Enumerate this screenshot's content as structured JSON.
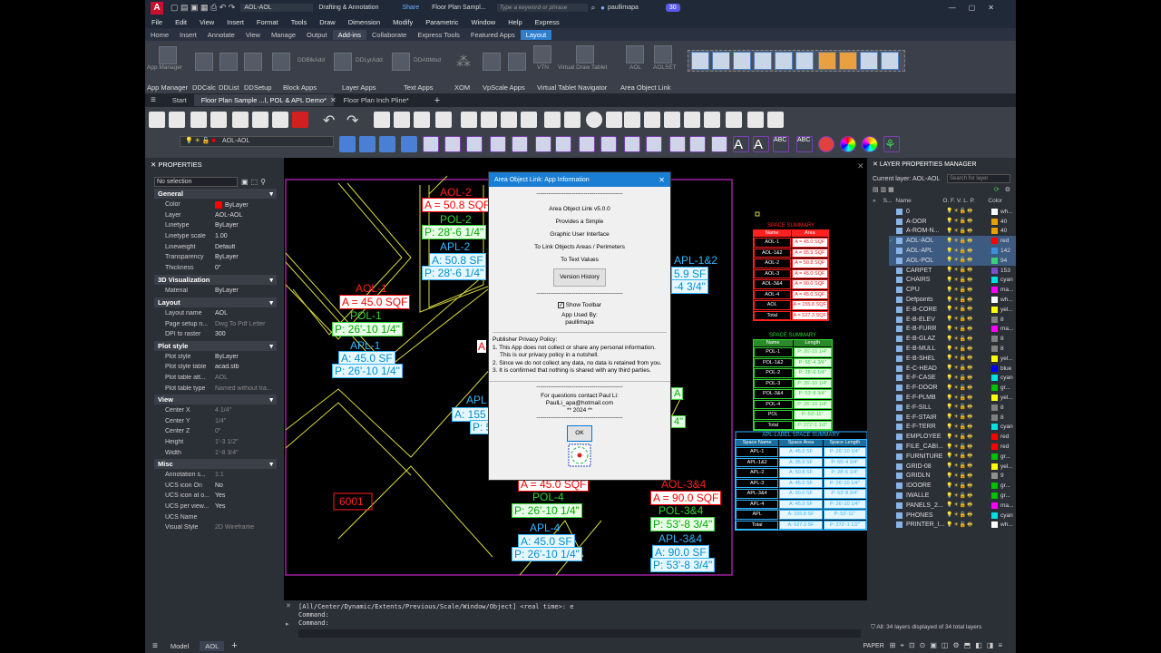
{
  "title_bar": {
    "app_badge": "A",
    "layer_combo": "AOL-AOL",
    "workspace": "Drafting & Annotation",
    "share": "Share",
    "doc_title": "Floor Plan Sampl...",
    "search_placeholder": "Type a keyword or phrase",
    "user": "paullimapa",
    "badge": "30"
  },
  "menu": [
    "File",
    "Edit",
    "View",
    "Insert",
    "Format",
    "Tools",
    "Draw",
    "Dimension",
    "Modify",
    "Parametric",
    "Window",
    "Help",
    "Express"
  ],
  "ribbon_tabs": [
    "Home",
    "Insert",
    "Annotate",
    "View",
    "Manage",
    "Output",
    "Add-ins",
    "Collaborate",
    "Express Tools",
    "Featured Apps",
    "Layout"
  ],
  "ribbon": {
    "icon_labels": [
      "App Manager",
      "DDBlkAdd",
      "DDLyrAdd",
      "DDAttMod",
      "VTN",
      "Virtual Draw Tablet",
      "AOL",
      "AOLSET"
    ],
    "panels": [
      "App Manager",
      "DDCalc",
      "DDList",
      "DDSetup",
      "Block Apps",
      "Layer Apps",
      "Text Apps",
      "XOM",
      "VpScale Apps",
      "Virtual Tablet Navigator",
      "Area Object Link"
    ]
  },
  "doc_tabs": [
    "Start",
    "Floor Plan Sample ...l, POL & APL Demo*",
    "Floor Plan Inch Pline*"
  ],
  "layer_toolbar_value": "AOL-AOL",
  "properties": {
    "header": "PROPERTIES",
    "selection": "No selection",
    "sections": [
      {
        "title": "General",
        "rows": [
          [
            "Color",
            "ByLayer"
          ],
          [
            "Layer",
            "AOL-AOL"
          ],
          [
            "Linetype",
            "ByLayer"
          ],
          [
            "Linetype scale",
            "1.00"
          ],
          [
            "Lineweight",
            "Default"
          ],
          [
            "Transparency",
            "ByLayer"
          ],
          [
            "Thickness",
            "0\""
          ]
        ]
      },
      {
        "title": "3D Visualization",
        "rows": [
          [
            "Material",
            "ByLayer"
          ]
        ]
      },
      {
        "title": "Layout",
        "rows": [
          [
            "Layout name",
            "AOL"
          ],
          [
            "Page setup n...",
            "Dwg To Pdf Letter"
          ],
          [
            "DPI to raster",
            "300"
          ]
        ]
      },
      {
        "title": "Plot style",
        "rows": [
          [
            "Plot style",
            "ByLayer"
          ],
          [
            "Plot style table",
            "acad.stb"
          ],
          [
            "Plot table att...",
            "AOL"
          ],
          [
            "Plot table type",
            "Named without tra..."
          ]
        ]
      },
      {
        "title": "View",
        "rows": [
          [
            "Center X",
            "4 1/4\""
          ],
          [
            "Center Y",
            "1/4\""
          ],
          [
            "Center Z",
            "0\""
          ],
          [
            "Height",
            "1'-3 1/2\""
          ],
          [
            "Width",
            "1'-8 3/4\""
          ]
        ]
      },
      {
        "title": "Misc",
        "rows": [
          [
            "Annotation s...",
            "1:1"
          ],
          [
            "UCS icon On",
            "No"
          ],
          [
            "UCS icon at o...",
            "Yes"
          ],
          [
            "UCS per view...",
            "Yes"
          ],
          [
            "UCS Name",
            ""
          ],
          [
            "Visual Style",
            "2D Wireframe"
          ]
        ]
      }
    ]
  },
  "drawing": {
    "labels": {
      "aol2": "AOL-2",
      "aol2_area": "A = 50.8 SQF",
      "pol2": "POL-2",
      "pol2_p": "P: 28'-6 1/4\"",
      "apl2": "APL-2",
      "apl2_a": "A: 50.8 SF",
      "apl2_p": "P: 28'-6 1/4\"",
      "aol1": "AOL-1",
      "aol1_area": "A = 45.0 SQF",
      "pol1": "POL-1",
      "pol1_p": "P: 26'-10 1/4\"",
      "apl1": "APL-1",
      "apl1_a": "A: 45.0 SF",
      "apl1_p": "P: 26'-10 1/4\"",
      "apl12": "APL-1&2",
      "apl12_a": "5.9 SF",
      "apl12_p": "-4 3/4\"",
      "aol4_area": "A = 45.0 SQF",
      "pol4": "POL-4",
      "pol4_p": "P: 26'-10 1/4\"",
      "apl4": "APL-4",
      "apl4_a": "A: 45.0 SF",
      "apl4_p": "P: 26'-10 1/4\"",
      "aol34": "AOL-3&4",
      "aol34_area": "A = 90.0 SQF",
      "pol34": "POL-3&4",
      "pol34_p": "P: 53'-8 3/4\"",
      "apl34": "APL-3&4",
      "apl34_a": "A: 90.0 SF",
      "apl34_p": "P: 53'-8 3/4\"",
      "room": "6001",
      "apl_partial": "APL",
      "a155": "A: 155",
      "p53": "P: 53"
    },
    "space_summary": {
      "title": "SPACE SUMMARY",
      "headers": [
        "Name",
        "Area"
      ],
      "rows": [
        [
          "AOL-1",
          "A = 45.0 SQF"
        ],
        [
          "AOL-1&2",
          "A = 95.9 SQF"
        ],
        [
          "AOL-2",
          "A = 50.8 SQF"
        ],
        [
          "AOL-3",
          "A = 45.0 SQF"
        ],
        [
          "AOL-3&4",
          "A = 90.0 SQF"
        ],
        [
          "AOL-4",
          "A = 45.0 SQF"
        ],
        [
          "AOL",
          "A = 155.8 SQF"
        ],
        [
          "Total",
          "A = 527.3 SQF"
        ]
      ]
    },
    "pol_summary": {
      "title": "SPACE SUMMARY",
      "headers": [
        "Name",
        "Length"
      ],
      "rows": [
        [
          "POL-1",
          "P: 26'-10 1/4\""
        ],
        [
          "POL-1&2",
          "P: 55'-4 3/4\""
        ],
        [
          "POL-2",
          "P: 28'-6 1/4\""
        ],
        [
          "POL-3",
          "P: 26'-10 1/4\""
        ],
        [
          "POL-3&4",
          "P: 53'-8 3/4\""
        ],
        [
          "POL-4",
          "P: 26'-10 1/4\""
        ],
        [
          "POL",
          "P: 53'-11\""
        ],
        [
          "Total",
          "P: 272'-1 1/2\""
        ]
      ]
    },
    "apl_summary": {
      "title": "APL-LABEL SPACE SUMMARY",
      "headers": [
        "Space Name",
        "Space Area",
        "Space Length"
      ],
      "rows": [
        [
          "APL-1",
          "A: 45.0 SF",
          "P: 26'-10 1/4\""
        ],
        [
          "APL-1&2",
          "A: 95.9 SF",
          "P: 55'-4 3/4\""
        ],
        [
          "APL-2",
          "A: 50.8 SF",
          "P: 28'-6 1/4\""
        ],
        [
          "APL-3",
          "A: 45.0 SF",
          "P: 26'-10 1/4\""
        ],
        [
          "APL-3&4",
          "A: 90.0 SF",
          "P: 53'-8 3/4\""
        ],
        [
          "APL-4",
          "A: 45.0 SF",
          "P: 26'-10 1/4\""
        ],
        [
          "APL",
          "A: 155.8 SF",
          "P: 53'-11\""
        ],
        [
          "Total",
          "A: 527.3 SF",
          "P: 272'-1 1/2\""
        ]
      ]
    }
  },
  "dialog": {
    "title": "Area Object Link: App Information",
    "dash": "--------------------------------------------",
    "version": "Area Object Link v5.0.0",
    "lines": [
      "Provides a Simple",
      "Graphic User Interface",
      "To Link Objects Areas / Perimeters",
      "To Text Values"
    ],
    "version_history_btn": "Version History",
    "show_toolbar": "Show Toolbar",
    "used_by_label": "App Used By:",
    "used_by": "paullimapa",
    "privacy_title": "Publisher Privacy Policy:",
    "privacy": [
      "1. This App does not collect or share any personal information.",
      "   This is our privacy policy in a nutshell.",
      "2. Since we do not collect any data, no data is retained from you.",
      "3. It is confirmed that nothing is shared with any third parties."
    ],
    "contact": "For questions contact Paul Li:",
    "email": "PaulLi_apa@hotmail.com",
    "year": "** 2024 **",
    "ok": "OK"
  },
  "command": {
    "history": "[All/Center/Dynamic/Extents/Previous/Scale/Window/Object] <real time>: e",
    "line1": "Command:",
    "line2": "Command:"
  },
  "layers_panel": {
    "header": "LAYER PROPERTIES MANAGER",
    "current": "Current layer: AOL-AOL",
    "search_placeholder": "Search for layer",
    "col_status": "S...",
    "col_name": "Name",
    "col_color": "Color",
    "footer": "All: 34 layers displayed of 34 total layers",
    "items": [
      {
        "name": "0",
        "color": "#ffffff",
        "label": "wh..."
      },
      {
        "name": "A-DOR",
        "color": "#e6a000",
        "label": "40"
      },
      {
        "name": "A-ROM-N...",
        "color": "#e6a000",
        "label": "40"
      },
      {
        "name": "AOL-AOL",
        "color": "#ff0000",
        "label": "red"
      },
      {
        "name": "AOL-APL",
        "color": "#3a8fd8",
        "label": "142"
      },
      {
        "name": "AOL-POL",
        "color": "#39d07a",
        "label": "94"
      },
      {
        "name": "CARPET",
        "color": "#7a4fc8",
        "label": "153"
      },
      {
        "name": "CHAIRS",
        "color": "#00e0e0",
        "label": "cyan"
      },
      {
        "name": "CPU",
        "color": "#ff00ff",
        "label": "ma..."
      },
      {
        "name": "Defpoints",
        "color": "#ffffff",
        "label": "wh..."
      },
      {
        "name": "E-B-CORE",
        "color": "#ffff00",
        "label": "yel..."
      },
      {
        "name": "E-B-ELEV",
        "color": "#808080",
        "label": "8"
      },
      {
        "name": "E-B-FURR",
        "color": "#ff00ff",
        "label": "ma..."
      },
      {
        "name": "E-B-GLAZ",
        "color": "#808080",
        "label": "8"
      },
      {
        "name": "E-B-MULL",
        "color": "#808080",
        "label": "8"
      },
      {
        "name": "E-B-SHEL",
        "color": "#ffff00",
        "label": "yel..."
      },
      {
        "name": "E-C-HEAD",
        "color": "#0000ff",
        "label": "blue"
      },
      {
        "name": "E-F-CASE",
        "color": "#00e0e0",
        "label": "cyan"
      },
      {
        "name": "E-F-DOOR",
        "color": "#00c000",
        "label": "gr..."
      },
      {
        "name": "E-F-PLMB",
        "color": "#ffff00",
        "label": "yel..."
      },
      {
        "name": "E-F-SILL",
        "color": "#808080",
        "label": "8"
      },
      {
        "name": "E-F-STAIR",
        "color": "#808080",
        "label": "8"
      },
      {
        "name": "E-F-TERR",
        "color": "#00e0e0",
        "label": "cyan"
      },
      {
        "name": "EMPLOYEE",
        "color": "#ff0000",
        "label": "red"
      },
      {
        "name": "FILE_CABI...",
        "color": "#ff0000",
        "label": "red"
      },
      {
        "name": "FURNITURE",
        "color": "#00c000",
        "label": "gr..."
      },
      {
        "name": "GRID-08",
        "color": "#ffff00",
        "label": "yel..."
      },
      {
        "name": "GRIDLN",
        "color": "#909090",
        "label": "9"
      },
      {
        "name": "IDOORE",
        "color": "#00c000",
        "label": "gr..."
      },
      {
        "name": "IWALLE",
        "color": "#00c000",
        "label": "gr..."
      },
      {
        "name": "PANELS_2...",
        "color": "#ff00ff",
        "label": "ma..."
      },
      {
        "name": "PHONES",
        "color": "#00e0e0",
        "label": "cyan"
      },
      {
        "name": "PRINTER_I...",
        "color": "#ffffff",
        "label": "wh..."
      }
    ]
  },
  "status": {
    "model_tab": "Model",
    "layout_tab": "AOL",
    "paper": "PAPER"
  },
  "colors": {
    "accent": "#1a7fd4",
    "aol": "#ff2020",
    "pol": "#33d433",
    "apl": "#33b5ff",
    "viewport": "#a020a0"
  }
}
